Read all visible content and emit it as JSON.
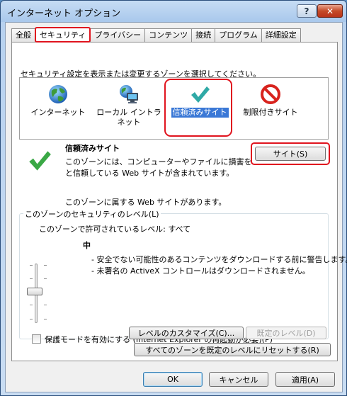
{
  "window": {
    "title": "インターネット オプション",
    "help_label": "?",
    "close_label": "✕"
  },
  "tabs": [
    {
      "label": "全般"
    },
    {
      "label": "セキュリティ"
    },
    {
      "label": "プライバシー"
    },
    {
      "label": "コンテンツ"
    },
    {
      "label": "接続"
    },
    {
      "label": "プログラム"
    },
    {
      "label": "詳細設定"
    }
  ],
  "security": {
    "instruction": "セキュリティ設定を表示または変更するゾーンを選択してください。",
    "zones": [
      {
        "label": "インターネット",
        "icon": "globe-icon"
      },
      {
        "label": "ローカル イントラネット",
        "icon": "intranet-icon"
      },
      {
        "label": "信頼済みサイト",
        "icon": "checkmark-icon",
        "selected": true
      },
      {
        "label": "制限付きサイト",
        "icon": "restricted-icon"
      }
    ],
    "zone_title": "信頼済みサイト",
    "zone_desc_1": "このゾーンには、コンピューターやファイルに損害を与えない",
    "zone_desc_2": "と信頼している Web サイトが含まれています。",
    "sites_button": "サイト(S)",
    "sites_note": "このゾーンに属する Web サイトがあります。",
    "level_group_title": "このゾーンのセキュリティのレベル(L)",
    "allowed_level": "このゾーンで許可されているレベル: すべて",
    "level_name": "中",
    "bullet_1": "- 安全でない可能性のあるコンテンツをダウンロードする前に警告します。",
    "bullet_2": "- 未署名の ActiveX コントロールはダウンロードされません。",
    "protected_mode_label": "保護モードを有効にする (Internet Explorer の再起動が必要)(P)",
    "protected_mode_checked": false,
    "custom_level_button": "レベルのカスタマイズ(C)...",
    "default_level_button": "既定のレベル(D)",
    "reset_all_button": "すべてのゾーンを既定のレベルにリセットする(R)"
  },
  "footer": {
    "ok": "OK",
    "cancel": "キャンセル",
    "apply": "適用(A)"
  },
  "colors": {
    "highlight": "#e0141e",
    "selection": "#3a78d6",
    "check_green": "#3aa845",
    "restricted_red": "#d8231e"
  }
}
